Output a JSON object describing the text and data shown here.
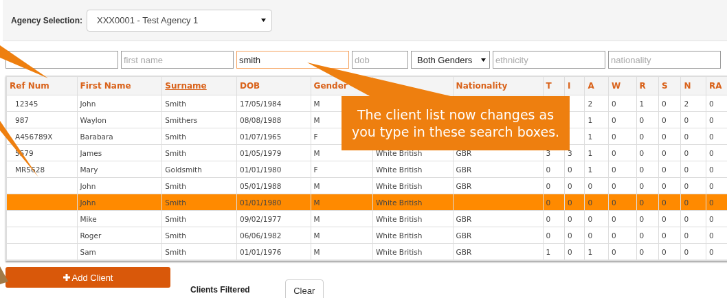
{
  "agency": {
    "label": "Agency Selection:",
    "value": "XXX0001 - Test Agency 1"
  },
  "filters": [
    {
      "kind": "text",
      "focused": false
    },
    {
      "kind": "text",
      "placeholder": "first name",
      "focused": false
    },
    {
      "kind": "text",
      "value": "smith",
      "focused": true
    },
    {
      "kind": "text",
      "placeholder": "dob",
      "focused": false
    },
    {
      "kind": "select",
      "value": "Both Genders"
    },
    {
      "kind": "text",
      "placeholder": "ethnicity",
      "focused": false
    },
    {
      "kind": "text",
      "placeholder": "nationality",
      "focused": false
    }
  ],
  "table": {
    "columns": [
      {
        "label": "Ref Num",
        "sorted": false
      },
      {
        "label": "First Name",
        "sorted": false
      },
      {
        "label": "Surname",
        "sorted": true
      },
      {
        "label": "DOB",
        "sorted": false
      },
      {
        "label": "Gender",
        "sorted": false
      },
      null,
      {
        "label": "Nationality",
        "sorted": false
      },
      {
        "label": "T",
        "sorted": false
      },
      {
        "label": "I",
        "sorted": false
      },
      {
        "label": "A",
        "sorted": false
      },
      {
        "label": "W",
        "sorted": false
      },
      {
        "label": "R",
        "sorted": false
      },
      {
        "label": "S",
        "sorted": false
      },
      {
        "label": "N",
        "sorted": false
      },
      {
        "label": "RA",
        "sorted": false
      }
    ],
    "rows": [
      {
        "selected": false,
        "cells": [
          "12345",
          "John",
          "Smith",
          "17/05/1984",
          "M",
          null,
          null,
          null,
          null,
          "2",
          "0",
          "1",
          "0",
          "2",
          "0"
        ]
      },
      {
        "selected": false,
        "cells": [
          "987",
          "Waylon",
          "Smithers",
          "08/08/1988",
          "M",
          null,
          null,
          null,
          null,
          "1",
          "0",
          "0",
          "0",
          "0",
          "0"
        ]
      },
      {
        "selected": false,
        "cells": [
          "A456789X",
          "Barabara",
          "Smith",
          "01/07/1965",
          "F",
          null,
          null,
          null,
          null,
          "1",
          "0",
          "0",
          "0",
          "0",
          "0"
        ]
      },
      {
        "selected": false,
        "cells": [
          "5579",
          "James",
          "Smith",
          "01/05/1979",
          "M",
          "White British",
          "GBR",
          "3",
          "3",
          "1",
          "0",
          "0",
          "0",
          "0",
          "0"
        ]
      },
      {
        "selected": false,
        "cells": [
          "MR5628",
          "Mary",
          "Goldsmith",
          "01/01/1980",
          "F",
          "White British",
          "GBR",
          "0",
          "0",
          "1",
          "0",
          "0",
          "0",
          "0",
          "0"
        ]
      },
      {
        "selected": false,
        "cells": [
          null,
          "John",
          "Smith",
          "05/01/1988",
          "M",
          "White British",
          "GBR",
          "0",
          "0",
          "0",
          "0",
          "0",
          "0",
          "0",
          "0"
        ]
      },
      {
        "selected": true,
        "cells": [
          null,
          "John",
          "Smith",
          "01/01/1980",
          "M",
          "White British",
          null,
          "0",
          "0",
          "0",
          "0",
          "0",
          "0",
          "0",
          "0"
        ]
      },
      {
        "selected": false,
        "cells": [
          null,
          "Mike",
          "Smith",
          "09/02/1977",
          "M",
          "White British",
          "GBR",
          "0",
          "0",
          "0",
          "0",
          "0",
          "0",
          "0",
          "0"
        ]
      },
      {
        "selected": false,
        "cells": [
          null,
          "Roger",
          "Smith",
          "06/06/1982",
          "M",
          "White British",
          "GBR",
          "0",
          "0",
          "0",
          "0",
          "0",
          "0",
          "0",
          "0"
        ]
      },
      {
        "selected": false,
        "cells": [
          null,
          "Sam",
          "Smith",
          "01/01/1976",
          "M",
          "White British",
          "GBR",
          "1",
          "0",
          "1",
          "0",
          "0",
          "0",
          "0",
          "0"
        ]
      }
    ]
  },
  "add_button": {
    "label": "Add Client"
  },
  "filter_status": "Clients Filtered",
  "clear_button": {
    "label": "Clear"
  },
  "callout": {
    "text": "The client list now changes as you type in these search boxes."
  }
}
